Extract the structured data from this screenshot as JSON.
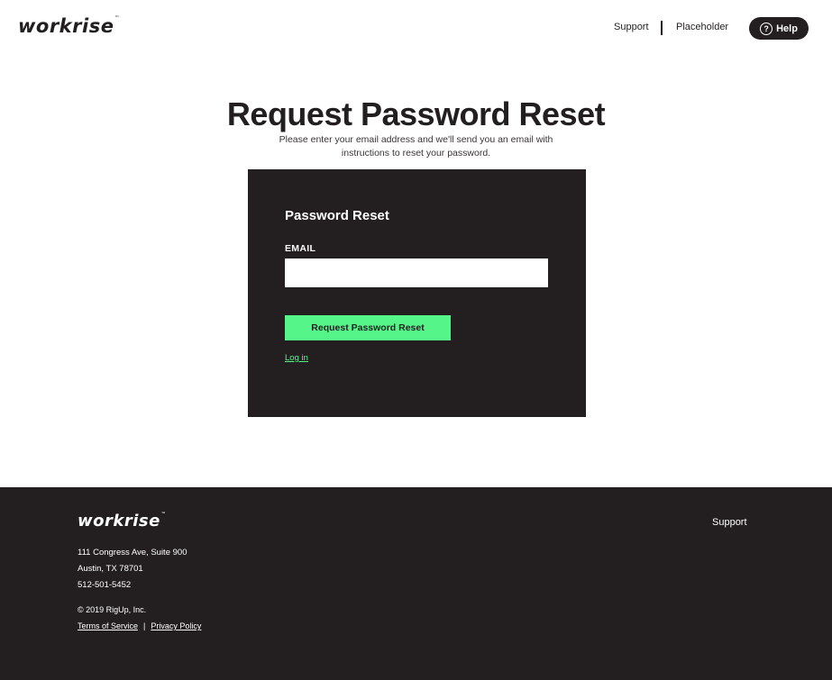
{
  "header": {
    "logo": "workrise",
    "logo_tm": "™",
    "nav": {
      "support": "Support",
      "placeholder": "Placeholder"
    },
    "help_label": "Help",
    "help_icon_glyph": "?"
  },
  "main": {
    "title": "Request Password Reset",
    "subtitle": "Please enter your email address and we'll send you an email with instructions to reset your password."
  },
  "form": {
    "title": "Password Reset",
    "email_label": "EMAIL",
    "email_value": "",
    "email_placeholder": "",
    "submit_label": "Request Password Reset",
    "login_link": "Log in",
    "accent_color": "#55f58a",
    "card_color": "#231f20"
  },
  "footer": {
    "logo": "workrise",
    "logo_tm": "™",
    "support": "Support",
    "address_line1": "111 Congress Ave, Suite 900",
    "address_line2": "Austin, TX 78701",
    "phone": "512-501-5452",
    "copyright": "© 2019 RigUp, Inc.",
    "terms": "Terms of Service",
    "separator": "|",
    "privacy": "Privacy Policy"
  }
}
